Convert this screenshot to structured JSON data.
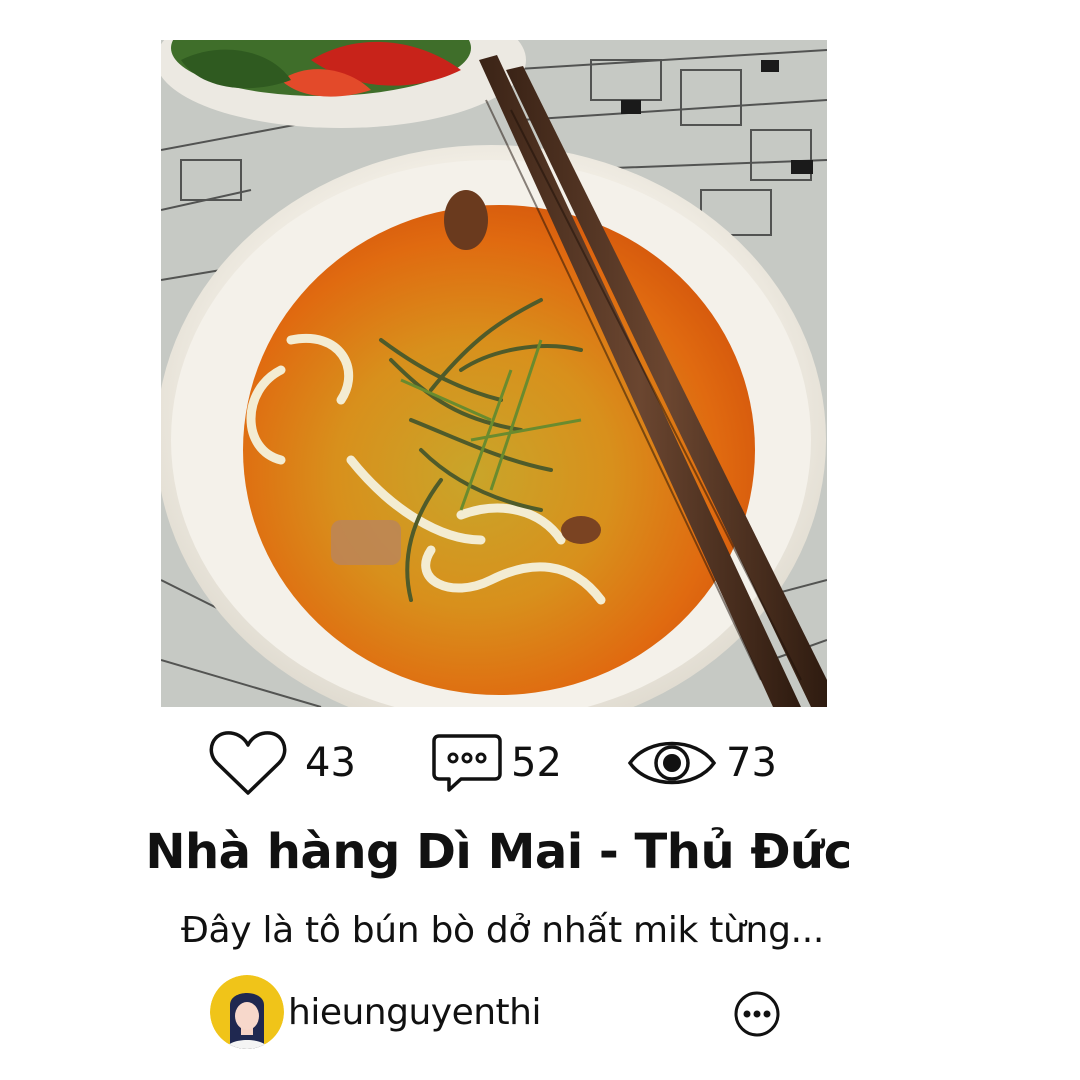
{
  "post": {
    "image": {
      "subject": "bowl-of-bun-bo-soup-with-chopsticks"
    },
    "stats": {
      "likes": "43",
      "comments": "52",
      "views": "73"
    },
    "title": "Nhà hàng Dì Mai - Thủ Đức",
    "description": "Đây là tô bún bò dở nhất mik từng...",
    "author": {
      "username": "hieunguyenthi"
    }
  },
  "icons": {
    "like": "heart-icon",
    "comment": "chat-bubble-icon",
    "view": "eye-icon",
    "more": "more-options-icon"
  },
  "colors": {
    "text": "#111111",
    "avatar_background": "#f0c419",
    "background": "#ffffff"
  }
}
